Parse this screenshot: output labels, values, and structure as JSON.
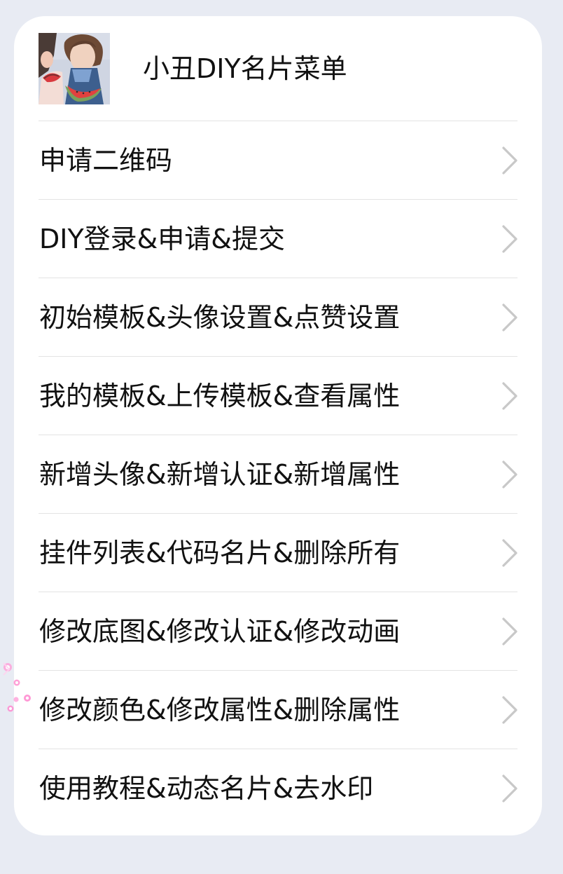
{
  "header": {
    "title": "小丑DIY名片菜单",
    "avatar_alt": "avatar"
  },
  "menu": {
    "items": [
      {
        "label": "申请二维码"
      },
      {
        "label": "DIY登录&申请&提交"
      },
      {
        "label": "初始模板&头像设置&点赞设置"
      },
      {
        "label": "我的模板&上传模板&查看属性"
      },
      {
        "label": "新增头像&新增认证&新增属性"
      },
      {
        "label": "挂件列表&代码名片&删除所有"
      },
      {
        "label": "修改底图&修改认证&修改动画"
      },
      {
        "label": "修改颜色&修改属性&删除属性"
      },
      {
        "label": "使用教程&动态名片&去水印"
      }
    ]
  },
  "colors": {
    "background": "#e8ebf3",
    "card": "#ffffff",
    "text": "#111111",
    "divider": "#e3e3e3",
    "chevron": "#c8c8c8",
    "sparkle": "#ff7cc8"
  },
  "icons": {
    "row_chevron": "chevron-right-icon",
    "decor": "sparkle-icon"
  }
}
